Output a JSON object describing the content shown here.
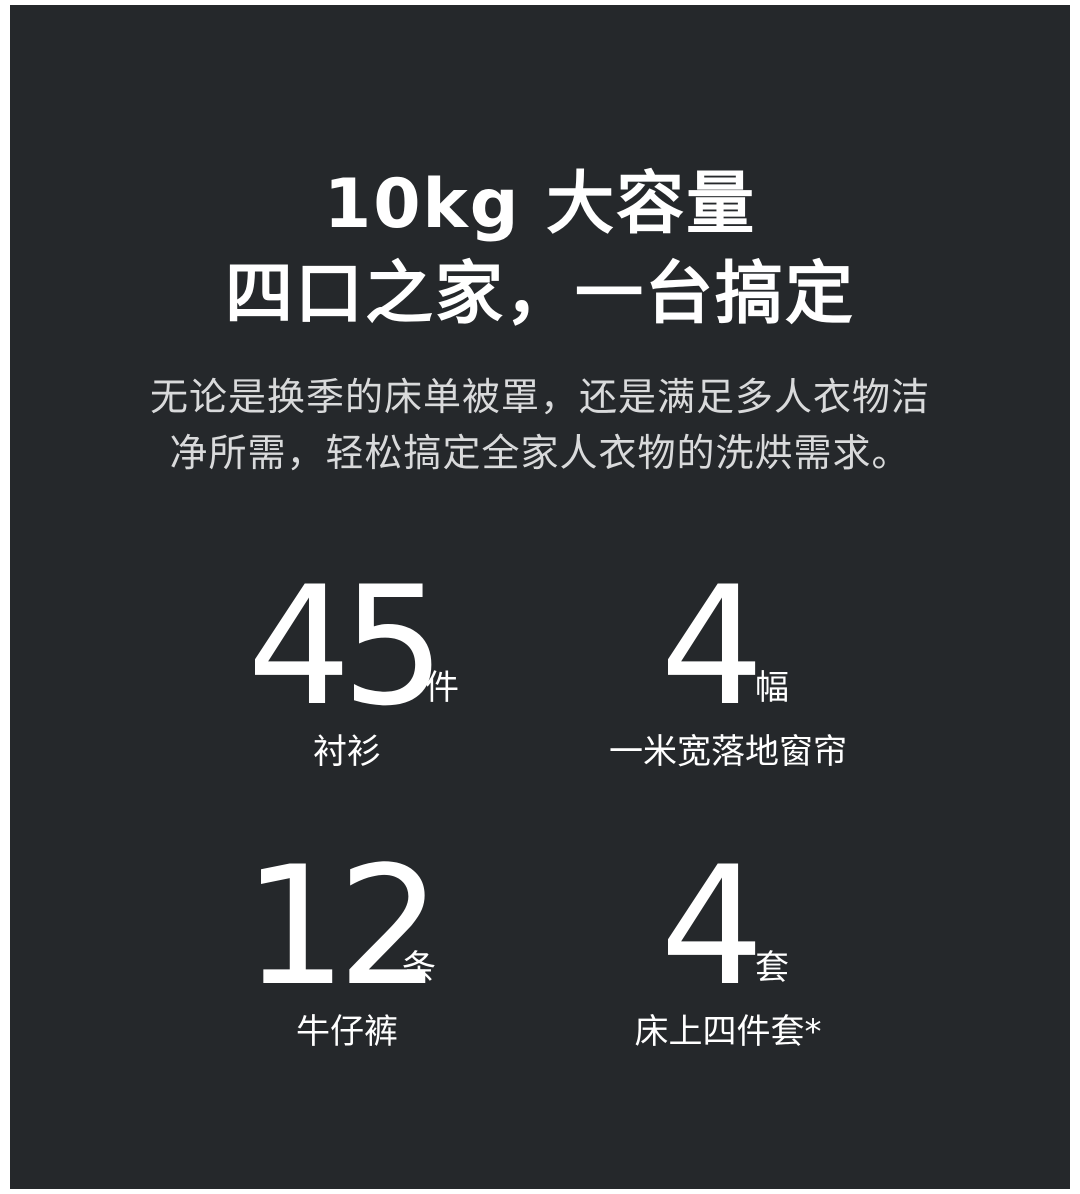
{
  "headline": {
    "line1": "10kg 大容量",
    "line2": "四口之家，一台搞定"
  },
  "description": {
    "line1": "无论是换季的床单被罩，还是满足多人衣物洁",
    "line2": "净所需，轻松搞定全家人衣物的洗烘需求。"
  },
  "stats": [
    {
      "number": "45",
      "unit": "件",
      "label": "衬衫"
    },
    {
      "number": "4",
      "unit": "幅",
      "label": "一米宽落地窗帘"
    },
    {
      "number": "12",
      "unit": "条",
      "label": "牛仔裤"
    },
    {
      "number": "4",
      "unit": "套",
      "label": "床上四件套*"
    }
  ],
  "colors": {
    "background": "#25282b",
    "text": "#ffffff",
    "description_text": "#d9dadb"
  }
}
